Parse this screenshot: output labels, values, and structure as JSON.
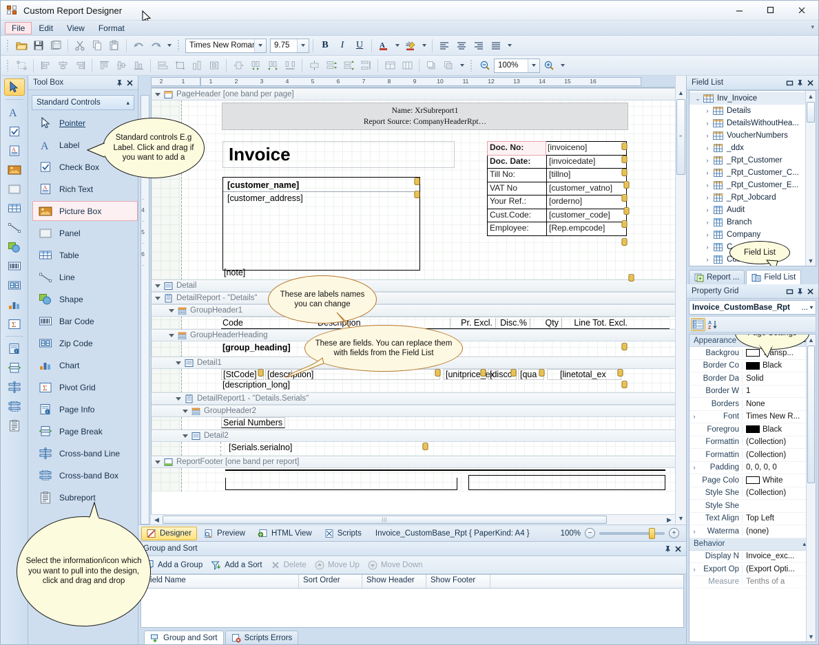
{
  "window": {
    "title": "Custom Report Designer",
    "minimize": "minimize-button",
    "maximize": "maximize-button",
    "close": "close-button"
  },
  "menu": {
    "items": [
      "File",
      "Edit",
      "View",
      "Format"
    ]
  },
  "toolbar": {
    "font_name": "Times New Roman",
    "font_size": "9.75",
    "bold": "B",
    "italic": "I",
    "underline": "U",
    "zoom": "100%"
  },
  "toolbox": {
    "title": "Tool Box",
    "group": "Standard Controls",
    "items": [
      {
        "label": "Pointer",
        "icon": "pointer-icon"
      },
      {
        "label": "Label",
        "icon": "label-icon"
      },
      {
        "label": "Check Box",
        "icon": "checkbox-icon"
      },
      {
        "label": "Rich Text",
        "icon": "richtext-icon"
      },
      {
        "label": "Picture Box",
        "icon": "picturebox-icon"
      },
      {
        "label": "Panel",
        "icon": "panel-icon"
      },
      {
        "label": "Table",
        "icon": "table-icon"
      },
      {
        "label": "Line",
        "icon": "line-icon"
      },
      {
        "label": "Shape",
        "icon": "shape-icon"
      },
      {
        "label": "Bar Code",
        "icon": "barcode-icon"
      },
      {
        "label": "Zip Code",
        "icon": "zipcode-icon"
      },
      {
        "label": "Chart",
        "icon": "chart-icon"
      },
      {
        "label": "Pivot Grid",
        "icon": "pivotgrid-icon"
      },
      {
        "label": "Page Info",
        "icon": "pageinfo-icon"
      },
      {
        "label": "Page Break",
        "icon": "pagebreak-icon"
      },
      {
        "label": "Cross-band Line",
        "icon": "crossbandline-icon"
      },
      {
        "label": "Cross-band Box",
        "icon": "crossbandbox-icon"
      },
      {
        "label": "Subreport",
        "icon": "subreport-icon"
      }
    ]
  },
  "callouts": [
    {
      "id": "standard-controls",
      "text": "Standard controls E.g Label. Click and drag if you want to add a"
    },
    {
      "id": "labels-names",
      "text": "These are labels names you can change"
    },
    {
      "id": "fields-replace",
      "text": "These are fields. You can replace them with fields from the Field List"
    },
    {
      "id": "field-list",
      "text": "Field List"
    },
    {
      "id": "page-settings",
      "text": "Page Settings"
    },
    {
      "id": "select-info",
      "text": "Select the information/icon which you want to pull into the design, click and drag and drop"
    }
  ],
  "ruler": {
    "horizontal": [
      "2",
      "1",
      "1",
      "2",
      "3",
      "4",
      "5",
      "6",
      "7",
      "8",
      "9",
      "10",
      "11",
      "12",
      "13",
      "14",
      "15",
      "16"
    ],
    "vertical": [
      "4",
      "5",
      "6"
    ]
  },
  "design": {
    "bands": [
      {
        "name": "PageHeader [one band per page]",
        "icon": "pageheader-band-icon"
      },
      {
        "name": "Detail",
        "icon": "detail-band-icon"
      },
      {
        "name": "DetailReport - \"Details\"",
        "icon": "detailreport-band-icon"
      },
      {
        "name": "GroupHeader1",
        "icon": "groupheader-band-icon"
      },
      {
        "name": "GroupHeaderHeading",
        "icon": "groupheader-band-icon"
      },
      {
        "name": "Detail1",
        "icon": "detail-band-icon"
      },
      {
        "name": "DetailReport1 - \"Details.Serials\"",
        "icon": "detailreport-band-icon"
      },
      {
        "name": "GroupHeader2",
        "icon": "groupheader-band-icon"
      },
      {
        "name": "Detail2",
        "icon": "detail-band-icon"
      },
      {
        "name": "ReportFooter [one band per report]",
        "icon": "reportfooter-band-icon"
      }
    ],
    "subreport": {
      "name_line": "Name: XrSubreport1",
      "source_line": "Report Source: CompanyHeaderRpt…"
    },
    "invoice_title": "Invoice",
    "customer_name": "[customer_name]",
    "customer_address": "[customer_address]",
    "note": "[note]",
    "info_rows": [
      {
        "key": "Doc. No:",
        "value": "[invoiceno]",
        "selected": true
      },
      {
        "key": "Doc. Date:",
        "value": "[invoicedate]",
        "selected": false
      },
      {
        "key": "Till No:",
        "value": "[tillno]",
        "selected": false
      },
      {
        "key": "VAT No",
        "value": "[customer_vatno]",
        "selected": false
      },
      {
        "key": "Your Ref.:",
        "value": "[orderno]",
        "selected": false
      },
      {
        "key": "Cust.Code:",
        "value": "[customer_code]",
        "selected": false
      },
      {
        "key": "Employee:",
        "value": "[Rep.empcode]",
        "selected": false
      }
    ],
    "column_headers": [
      "Code",
      "Description",
      "Pr. Excl.",
      "Disc.%",
      "Qty",
      "Line Tot. Excl."
    ],
    "group_heading": "[group_heading]",
    "detail_fields": [
      "[StCode]",
      "[description]",
      "[unitprice_ex",
      "[disco",
      "[qua",
      "[linetotal_ex"
    ],
    "description_long": "[description_long]",
    "serial_numbers_label": "Serial Numbers",
    "serialno_field": "[Serials.serialno]"
  },
  "designer_tabs": {
    "tabs": [
      {
        "label": "Designer",
        "icon": "designer-icon",
        "active": true
      },
      {
        "label": "Preview",
        "icon": "preview-icon",
        "active": false
      },
      {
        "label": "HTML View",
        "icon": "htmlview-icon",
        "active": false
      },
      {
        "label": "Scripts",
        "icon": "scripts-icon",
        "active": false
      }
    ],
    "doc_title": "Invoice_CustomBase_Rpt { PaperKind: A4 }",
    "zoom_label": "100%"
  },
  "field_list": {
    "title": "Field List",
    "items": [
      {
        "label": "Inv_Invoice",
        "level": 0,
        "expanded": true
      },
      {
        "label": "Details",
        "level": 1,
        "expanded": false
      },
      {
        "label": "DetailsWithoutHea...",
        "level": 1,
        "expanded": false
      },
      {
        "label": "VoucherNumbers",
        "level": 1,
        "expanded": false
      },
      {
        "label": "_ddx",
        "level": 1,
        "expanded": false
      },
      {
        "label": "_Rpt_Customer",
        "level": 1,
        "expanded": false
      },
      {
        "label": "_Rpt_Customer_C...",
        "level": 1,
        "expanded": false
      },
      {
        "label": "_Rpt_Customer_E...",
        "level": 1,
        "expanded": false
      },
      {
        "label": "_Rpt_Jobcard",
        "level": 1,
        "expanded": false
      },
      {
        "label": "Audit",
        "level": 1,
        "expanded": false
      },
      {
        "label": "Branch",
        "level": 1,
        "expanded": false
      },
      {
        "label": "Company",
        "level": 1,
        "expanded": false
      },
      {
        "label": "C",
        "level": 1,
        "expanded": false
      },
      {
        "label": "Cust",
        "level": 1,
        "expanded": false
      }
    ],
    "tabs": [
      {
        "label": "Report ...",
        "icon": "report-explorer-icon",
        "active": false
      },
      {
        "label": "Field List",
        "icon": "field-list-icon",
        "active": true
      }
    ]
  },
  "property_grid": {
    "title": "Property Grid",
    "object": "Invoice_CustomBase_Rpt",
    "object_suffix": "...",
    "categories": [
      {
        "name": "Appearance",
        "rows": [
          {
            "key": "Backgrou",
            "value": "Transp...",
            "swatch": "#ffffff",
            "expandable": false
          },
          {
            "key": "Border Co",
            "value": "Black",
            "swatch": "#000000",
            "expandable": false
          },
          {
            "key": "Border Da",
            "value": "Solid",
            "expandable": false
          },
          {
            "key": "Border W",
            "value": "1",
            "expandable": false
          },
          {
            "key": "Borders",
            "value": "None",
            "expandable": false
          },
          {
            "key": "Font",
            "value": "Times New R...",
            "expandable": true
          },
          {
            "key": "Foregrou",
            "value": "Black",
            "swatch": "#000000",
            "expandable": false
          },
          {
            "key": "Formattin",
            "value": "(Collection)",
            "expandable": false
          },
          {
            "key": "Formattin",
            "value": "(Collection)",
            "expandable": false
          },
          {
            "key": "Padding",
            "value": "0, 0, 0, 0",
            "expandable": true
          },
          {
            "key": "Page Colo",
            "value": "White",
            "swatch": "#ffffff",
            "expandable": false
          },
          {
            "key": "Style She",
            "value": "(Collection)",
            "expandable": false
          },
          {
            "key": "Style She",
            "value": "",
            "expandable": false
          },
          {
            "key": "Text Align",
            "value": "Top Left",
            "expandable": false
          },
          {
            "key": "Waterma",
            "value": "(none)",
            "expandable": true
          }
        ]
      },
      {
        "name": "Behavior",
        "rows": [
          {
            "key": "Display N",
            "value": "Invoice_exc...",
            "expandable": false
          },
          {
            "key": "Export Op",
            "value": "(Export Opti...",
            "expandable": true
          },
          {
            "key": "Measure",
            "value": "Tenths of a",
            "expandable": false
          }
        ]
      }
    ]
  },
  "group_sort": {
    "title": "Group and Sort",
    "actions": [
      {
        "label": "Add a Group",
        "icon": "add-group-icon",
        "enabled": true
      },
      {
        "label": "Add a Sort",
        "icon": "add-sort-icon",
        "enabled": true
      },
      {
        "label": "Delete",
        "icon": "delete-icon",
        "enabled": false
      },
      {
        "label": "Move Up",
        "icon": "move-up-icon",
        "enabled": false
      },
      {
        "label": "Move Down",
        "icon": "move-down-icon",
        "enabled": false
      }
    ],
    "columns": [
      "Field Name",
      "Sort Order",
      "Show Header",
      "Show Footer"
    ],
    "rows": [],
    "tabs": [
      {
        "label": "Group and Sort",
        "icon": "group-sort-icon",
        "active": true
      },
      {
        "label": "Scripts Errors",
        "icon": "scripts-errors-icon",
        "active": false
      }
    ]
  },
  "colors": {
    "accent": "#ffe27a",
    "panel": "#cfdeee",
    "selection_border": "#e8a6ae"
  }
}
